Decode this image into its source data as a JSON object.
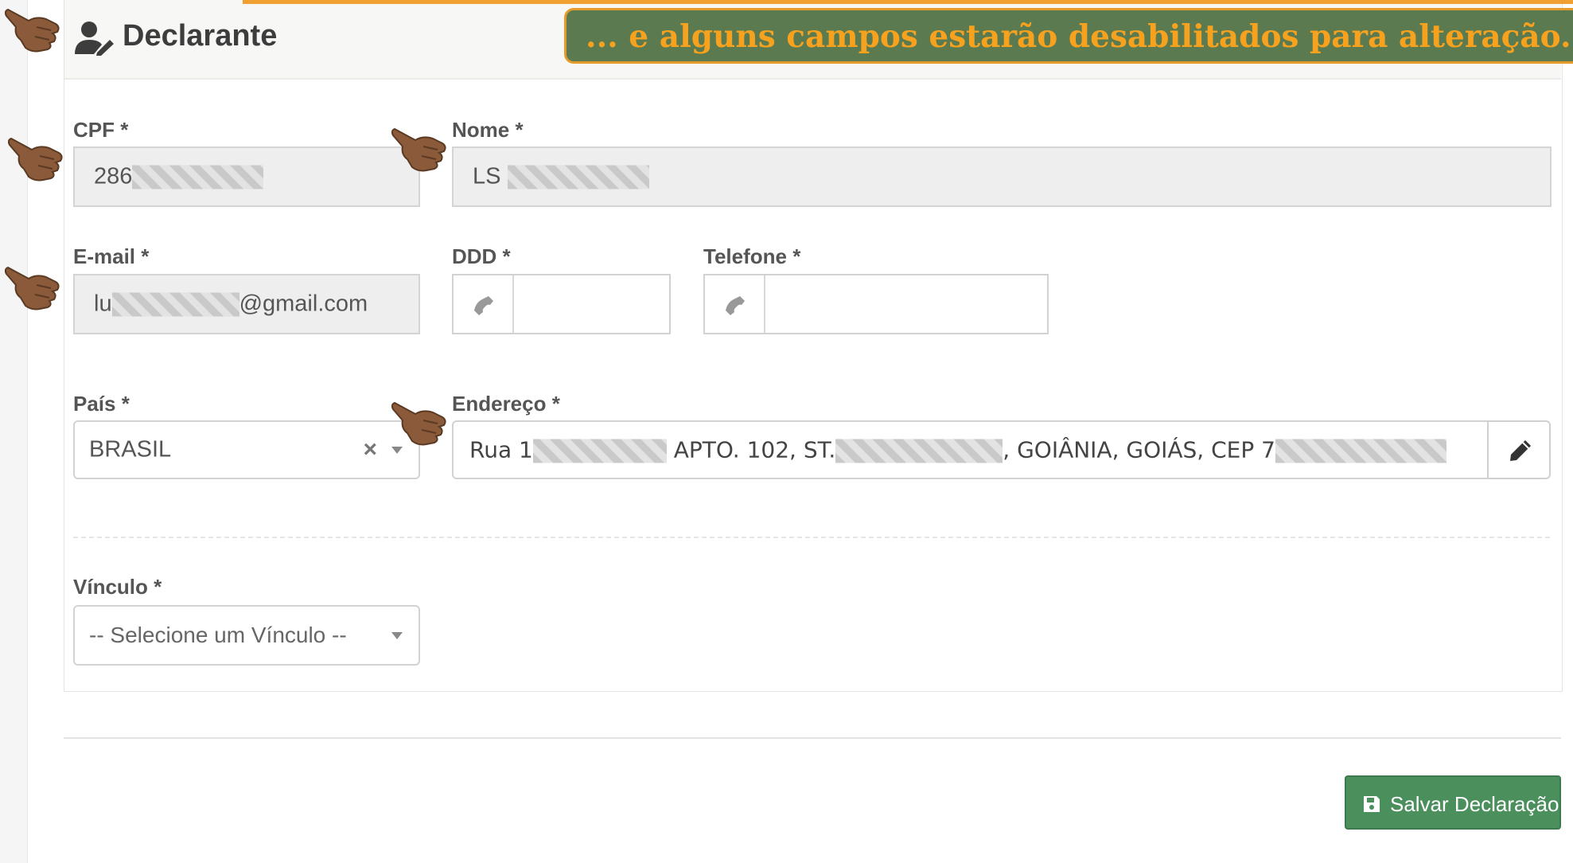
{
  "header": {
    "title": "Declarante"
  },
  "callout": {
    "text": "... e alguns campos estarão desabilitados para alteração."
  },
  "form": {
    "cpf": {
      "label": "CPF *",
      "value": "286"
    },
    "nome": {
      "label": "Nome *",
      "value": "LS"
    },
    "email": {
      "label": "E-mail *",
      "prefix": "lu",
      "suffix": "@gmail.com"
    },
    "ddd": {
      "label": "DDD *",
      "value": ""
    },
    "telefone": {
      "label": "Telefone *",
      "value": ""
    },
    "pais": {
      "label": "País *",
      "value": "BRASIL",
      "clear": "×"
    },
    "endereco": {
      "label": "Endereço *",
      "parts": [
        "Rua 1",
        "APTO. 102, ST.",
        ", GOIÂNIA, GOIÁS, CEP 7"
      ]
    },
    "vinculo": {
      "label": "Vínculo *",
      "placeholder": "-- Selecione um Vínculo --"
    }
  },
  "actions": {
    "save_label": "Salvar Declaração"
  },
  "colors": {
    "accent_green": "#4a8f5c",
    "callout_bg": "#5b7a4f",
    "callout_text": "#f6a21f",
    "hand": "#8a5a3a"
  },
  "icons": [
    "user-edit-icon",
    "phone-icon",
    "pencil-icon",
    "floppy-disk-icon",
    "pointing-hand-icon"
  ]
}
